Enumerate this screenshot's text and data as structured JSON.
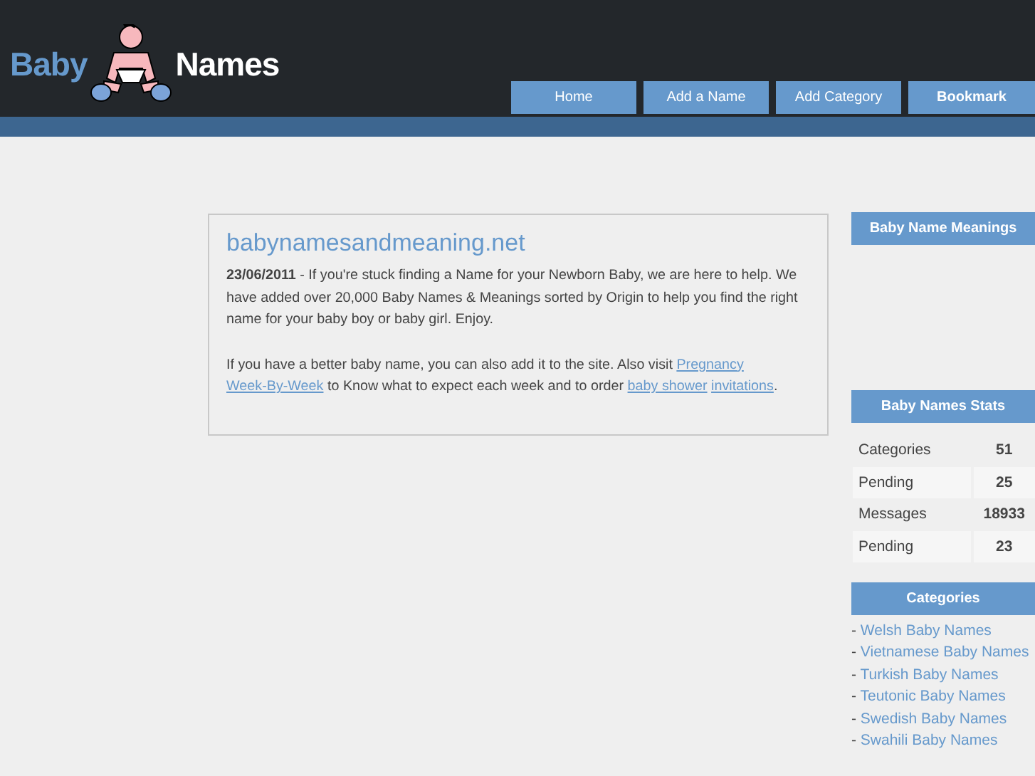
{
  "logo": {
    "first": "Baby",
    "second": "Names"
  },
  "nav": [
    {
      "label": "Home",
      "bold": false
    },
    {
      "label": "Add a Name",
      "bold": false
    },
    {
      "label": "Add Category",
      "bold": false
    },
    {
      "label": "Bookmark",
      "bold": true
    }
  ],
  "article": {
    "title": "babynamesandmeaning.net",
    "intro": "**23/06/2011** - If you're stuck finding a Name for your Newborn Baby, we are here to help. We have added over 20,000 Baby Names & Meanings sorted by Origin to help you find the right name for your baby boy or baby girl. Enjoy.",
    "paragraph": [
      {
        "kind": "text",
        "text": "If you have a better baby name, you can also add it to the site. Also visit "
      },
      {
        "kind": "link",
        "lines": [
          "Pregnancy",
          "Week-By-Week"
        ]
      },
      {
        "kind": "text",
        "text": " to Know what to expect each week and to order "
      },
      {
        "kind": "link",
        "lines": [
          "baby shower",
          "invitations"
        ]
      },
      {
        "kind": "text",
        "text": "."
      }
    ]
  },
  "sidebar": {
    "meanings_title": "Baby Name Meanings",
    "stats_title": "Baby Names Stats",
    "stats": [
      {
        "label": "Categories",
        "value": "51"
      },
      {
        "label": "Pending",
        "value": "25"
      },
      {
        "label": "Messages",
        "value": "18933"
      },
      {
        "label": "Pending",
        "value": "23"
      }
    ],
    "categories_title": "Categories",
    "categories": [
      {
        "bullet": "-",
        "label": "Welsh Baby Names"
      },
      {
        "bullet": "-",
        "label": "Vietnamese Baby Names"
      },
      {
        "bullet": "-",
        "label": "Turkish Baby Names"
      },
      {
        "bullet": "-",
        "label": "Teutonic Baby Names"
      },
      {
        "bullet": "-",
        "label": "Swedish Baby Names"
      },
      {
        "bullet": "-",
        "label": "Swahili Baby Names"
      }
    ]
  }
}
